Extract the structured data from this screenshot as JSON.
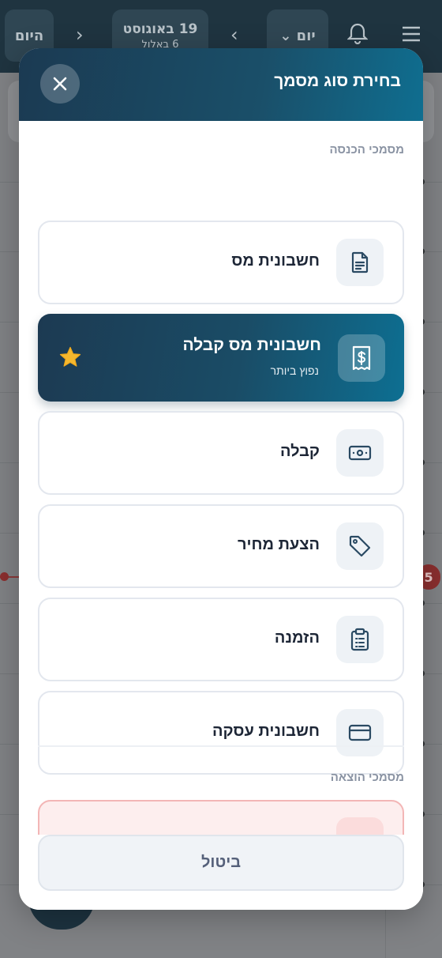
{
  "background": {
    "today_label": "היום",
    "date_main": "19 באוגוסט",
    "date_sub": "6 באלול",
    "view_label": "יום",
    "time_badge": "5"
  },
  "modal": {
    "title": "בחירת סוג מסמך",
    "income_section": "מסמכי הכנסה",
    "expense_section": "מסמכי הוצאה",
    "cancel_label": "ביטול",
    "items": [
      {
        "label": "חשבונית מס",
        "icon": "document-icon"
      },
      {
        "label": "חשבונית מס קבלה",
        "sublabel": "נפוץ ביותר",
        "icon": "receipt-dollar-icon",
        "featured": true
      },
      {
        "label": "קבלה",
        "icon": "cash-icon"
      },
      {
        "label": "הצעת מחיר",
        "icon": "tag-icon"
      },
      {
        "label": "הזמנה",
        "icon": "clipboard-icon"
      },
      {
        "label": "חשבונית עסקה",
        "icon": "credit-card-icon"
      }
    ]
  },
  "colors": {
    "header_dark": "#1b3a52",
    "header_light": "#0f6e90",
    "star": "#f5b82e",
    "expense_border": "#f3b6b6"
  }
}
